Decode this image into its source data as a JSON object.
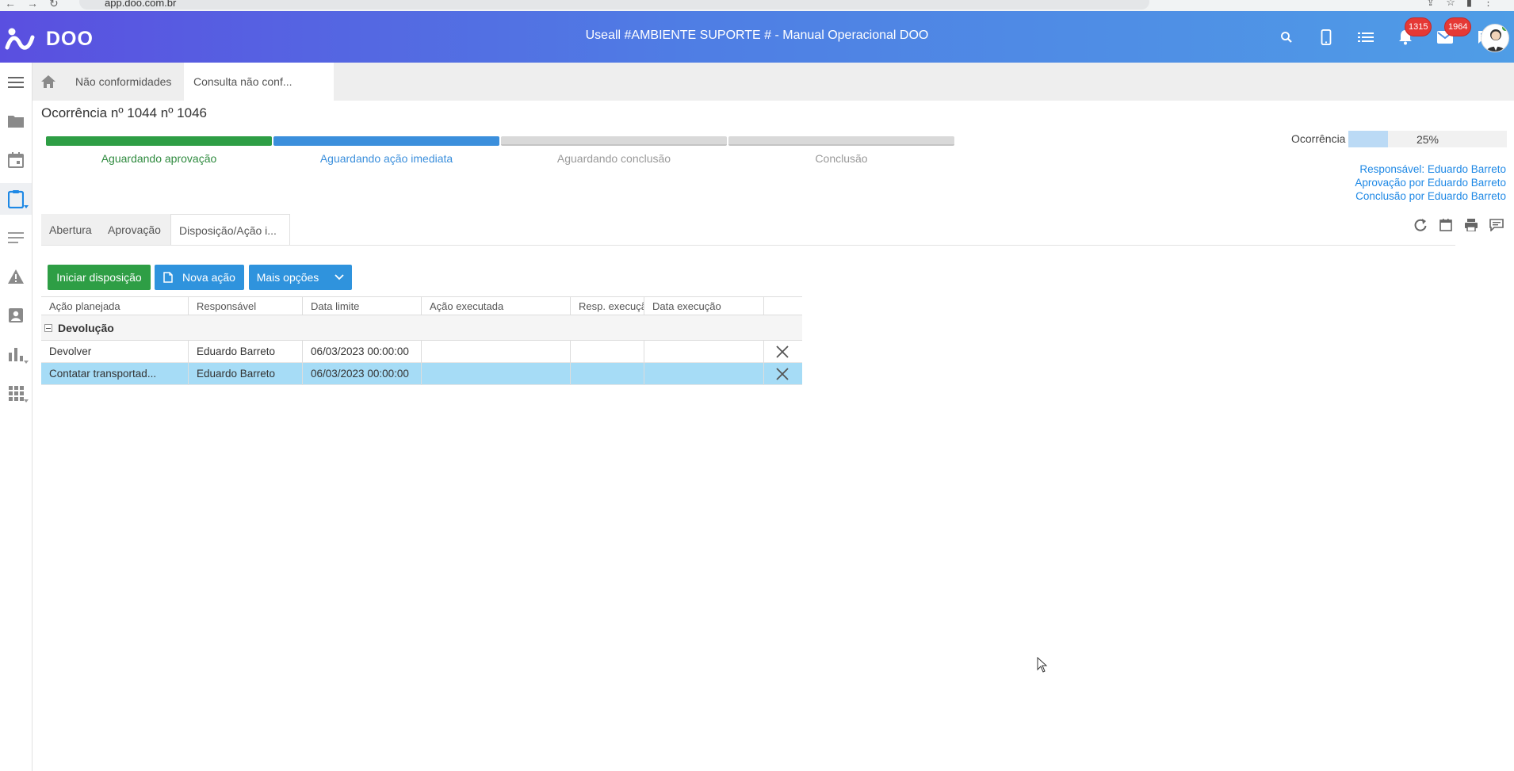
{
  "browser": {
    "url": "app.doo.com.br"
  },
  "app": {
    "logo_text": "DOO",
    "title": "Useall #AMBIENTE SUPORTE # - Manual Operacional DOO",
    "notifications_count": "1315",
    "messages_count": "1964"
  },
  "icons": {
    "top": [
      "search-icon",
      "mobile-icon",
      "list-icon",
      "bell-icon",
      "mail-icon",
      "chat-icon"
    ],
    "sidebar": [
      "menu-icon",
      "folder-icon",
      "calendar-icon",
      "clipboard-icon",
      "notes-icon",
      "warning-icon",
      "contact-icon",
      "chart-icon",
      "apps-icon"
    ],
    "tools": [
      "refresh-icon",
      "calendar-icon",
      "print-icon",
      "comment-icon"
    ]
  },
  "breadcrumb": {
    "tabs": [
      {
        "label": "Não conformidades"
      },
      {
        "label": "Consulta não conf..."
      }
    ]
  },
  "page": {
    "title": "Ocorrência nº 1044 nº 1046"
  },
  "steps": [
    {
      "label": "Aguardando aprovação",
      "color": "#2e9e45",
      "text_color": "#2e8a3e"
    },
    {
      "label": "Aguardando ação imediata",
      "color": "#3b8fdc",
      "text_color": "#3b8fdc"
    },
    {
      "label": "Aguardando conclusão",
      "color": "#d9d9d9",
      "text_color": "#999999"
    },
    {
      "label": "Conclusão",
      "color": "#d9d9d9",
      "text_color": "#999999"
    }
  ],
  "progress": {
    "label": "Ocorrência",
    "value_text": "25%",
    "value": 0.25
  },
  "meta": {
    "responsavel": "Responsável: Eduardo Barreto",
    "aprovacao": "Aprovação por Eduardo Barreto",
    "conclusao": "Conclusão por Eduardo Barreto"
  },
  "subtabs": [
    {
      "label": "Abertura"
    },
    {
      "label": "Aprovação"
    },
    {
      "label": "Disposição/Ação i..."
    }
  ],
  "toolbar": {
    "iniciar_label": "Iniciar disposição",
    "nova_label": "Nova ação",
    "mais_label": "Mais opções"
  },
  "grid": {
    "columns": [
      "Ação planejada",
      "Responsável",
      "Data limite",
      "Ação executada",
      "Resp. execução",
      "Data execução"
    ],
    "group": "Devolução",
    "rows": [
      {
        "acao": "Devolver",
        "responsavel": "Eduardo Barreto",
        "data_limite": "06/03/2023 00:00:00",
        "acao_exec": "",
        "resp_exec": "",
        "data_exec": ""
      },
      {
        "acao": "Contatar transportad...",
        "responsavel": "Eduardo Barreto",
        "data_limite": "06/03/2023 00:00:00",
        "acao_exec": "",
        "resp_exec": "",
        "data_exec": ""
      }
    ]
  },
  "colors": {
    "green": "#2e9e45",
    "blue": "#2f93dd",
    "selected_row": "#a6dcf6"
  }
}
